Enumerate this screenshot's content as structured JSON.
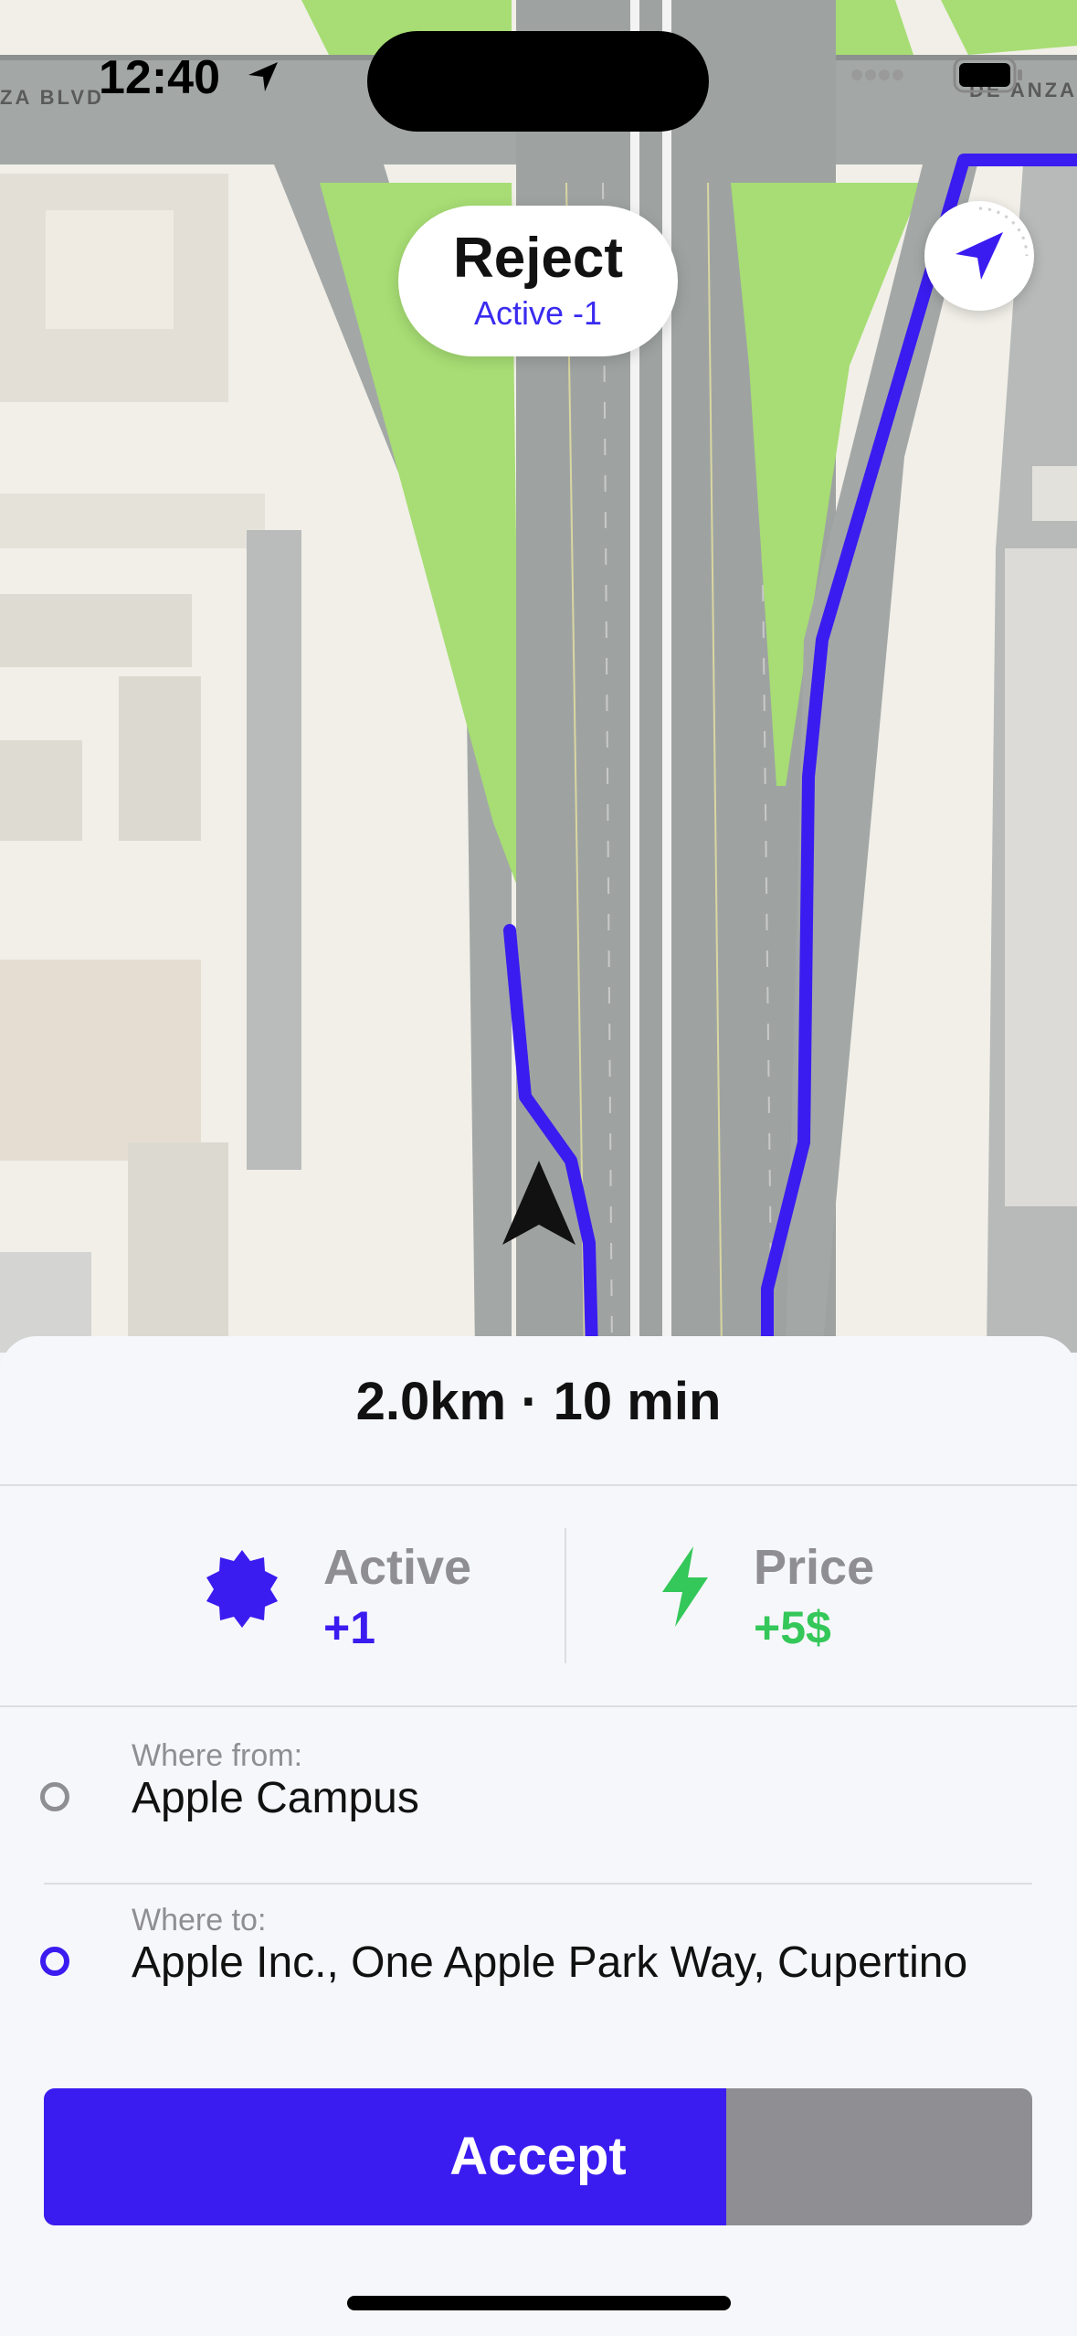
{
  "status_bar": {
    "time": "12:40",
    "street_left": "ZA BLVD",
    "street_right": "DE ANZA"
  },
  "map": {
    "reject_button": {
      "title": "Reject",
      "subtitle": "Active -1"
    },
    "route_color": "#3a1cf0",
    "grass_color": "#a7dd74",
    "road_color": "#9ea3a2",
    "icons": {
      "recenter": "location-arrow-icon",
      "vehicle": "navigation-arrow-icon"
    }
  },
  "sheet": {
    "route_summary": "2.0km · 10 min",
    "bonuses": [
      {
        "label": "Active",
        "value": "+1",
        "icon": "badge-icon",
        "color": "#3a1cf0"
      },
      {
        "label": "Price",
        "value": "+5$",
        "icon": "lightning-icon",
        "color": "#34c759"
      }
    ],
    "from": {
      "label": "Where from:",
      "value": "Apple Campus"
    },
    "to": {
      "label": "Where to:",
      "value": "Apple Inc., One Apple Park Way, Cupertino"
    },
    "accept": {
      "label": "Accept",
      "countdown_fraction": 0.69
    }
  }
}
